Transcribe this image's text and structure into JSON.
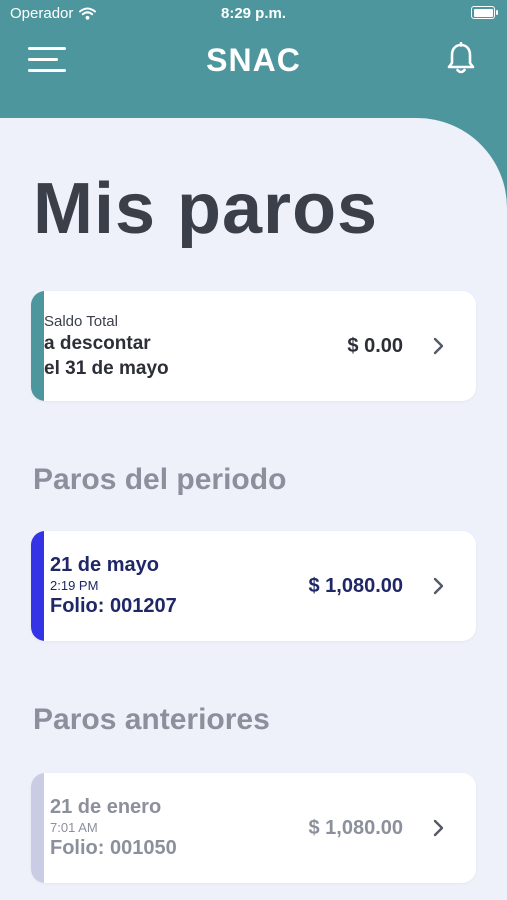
{
  "status_bar": {
    "carrier": "Operador",
    "time": "8:29 p.m."
  },
  "header": {
    "title": "SNAC"
  },
  "page": {
    "title": "Mis paros"
  },
  "summary": {
    "line1": "Saldo Total",
    "line2": "a descontar",
    "line3": "el 31 de mayo",
    "amount": "$ 0.00"
  },
  "sections": {
    "current_title": "Paros del periodo",
    "previous_title": "Paros anteriores"
  },
  "current_paros": [
    {
      "date": "21 de mayo",
      "time": "2:19 PM",
      "folio": "Folio: 001207",
      "amount": "$ 1,080.00"
    }
  ],
  "previous_paros": [
    {
      "date": "21 de enero",
      "time": "7:01 AM",
      "folio": "Folio: 001050",
      "amount": "$ 1,080.00"
    }
  ],
  "colors": {
    "header": "#4d969d",
    "background": "#eef0fa",
    "current_accent": "#3434e6",
    "previous_accent": "#c9cce3",
    "summary_accent": "#4d969d"
  },
  "icons": [
    "wifi-icon",
    "battery-icon",
    "menu-icon",
    "bell-icon",
    "chevron-right-icon"
  ]
}
